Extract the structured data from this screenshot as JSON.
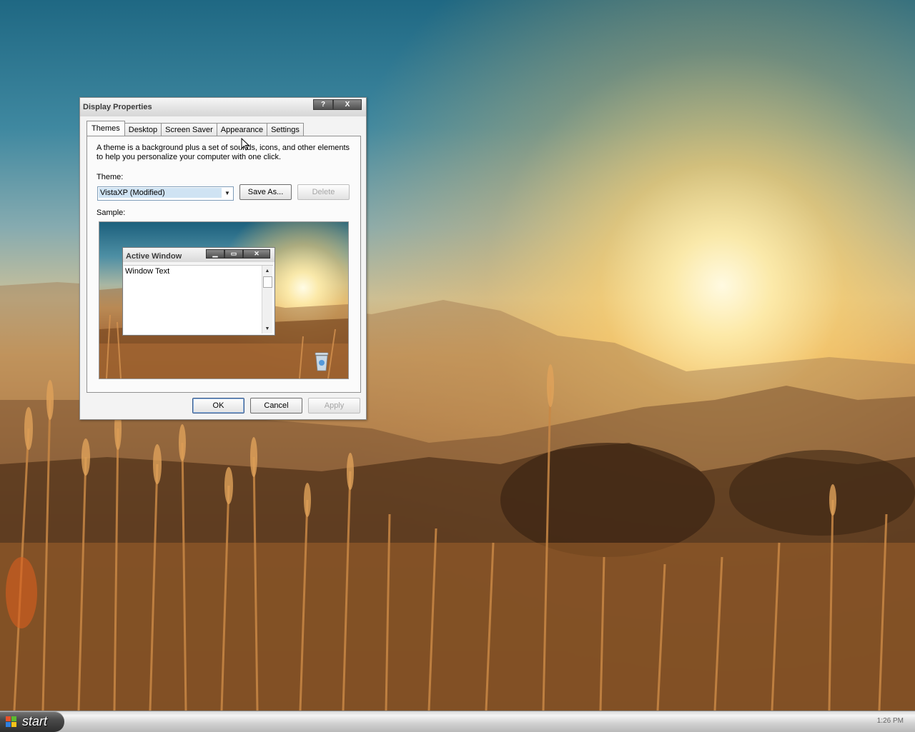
{
  "window": {
    "title": "Display Properties",
    "help_label": "?",
    "close_label": "X"
  },
  "tabs": [
    {
      "label": "Themes",
      "active": true
    },
    {
      "label": "Desktop",
      "active": false
    },
    {
      "label": "Screen Saver",
      "active": false
    },
    {
      "label": "Appearance",
      "active": false
    },
    {
      "label": "Settings",
      "active": false
    }
  ],
  "themes_tab": {
    "description": "A theme is a background plus a set of sounds, icons, and other elements to help you personalize your computer with one click.",
    "theme_label": "Theme:",
    "theme_value": "VistaXP (Modified)",
    "save_as_label": "Save As...",
    "delete_label": "Delete",
    "sample_label": "Sample:",
    "sample": {
      "window_title": "Active Window",
      "window_text": "Window Text"
    }
  },
  "buttons": {
    "ok": "OK",
    "cancel": "Cancel",
    "apply": "Apply"
  },
  "taskbar": {
    "start_label": "start",
    "clock": "1:26 PM"
  },
  "icons": [
    "help-icon",
    "close-icon",
    "dropdown-arrow-icon",
    "minimize-icon",
    "maximize-icon",
    "scroll-up-icon",
    "scroll-down-icon",
    "recycle-bin-icon",
    "windows-flag-icon",
    "mouse-cursor-icon"
  ],
  "colors": {
    "selection_bg": "#cfe3f3",
    "title_text": "#3b3b3b",
    "disabled_text": "#a5a5a5"
  }
}
